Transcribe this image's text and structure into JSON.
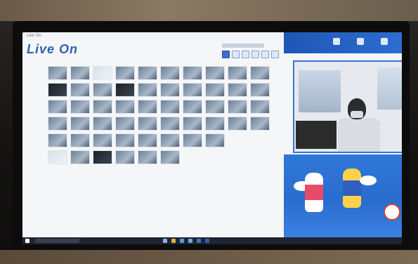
{
  "window": {
    "title": "Live On"
  },
  "app": {
    "brand": "Live On",
    "subtitle": "",
    "status_text": "",
    "page_text": ""
  },
  "video": {
    "label": ""
  },
  "colors": {
    "brand_blue": "#2b5fb8",
    "header_blue": "#1d57b5",
    "mascot_bg": "#2f78d8",
    "taskbar": "#1f2430"
  },
  "taskbar": {
    "search_placeholder": "",
    "clock": ""
  },
  "icons": [
    "windows-icon",
    "search-icon",
    "task-view-icon",
    "chrome-icon",
    "explorer-icon",
    "store-icon",
    "mail-icon",
    "liveon-icon"
  ],
  "thumbnails": {
    "rows": [
      {
        "count": 10,
        "kinds": [
          "n",
          "n",
          "l",
          "n",
          "n",
          "n",
          "n",
          "n",
          "n",
          "n"
        ]
      },
      {
        "count": 10,
        "kinds": [
          "d",
          "n",
          "n",
          "d",
          "n",
          "n",
          "n",
          "n",
          "n",
          "n"
        ]
      },
      {
        "count": 10,
        "kinds": [
          "n",
          "n",
          "n",
          "n",
          "n",
          "n",
          "n",
          "n",
          "n",
          "n"
        ]
      },
      {
        "count": 10,
        "kinds": [
          "n",
          "n",
          "n",
          "n",
          "n",
          "n",
          "n",
          "n",
          "n",
          "n"
        ]
      },
      {
        "count": 8,
        "kinds": [
          "n",
          "n",
          "n",
          "n",
          "n",
          "n",
          "n",
          "n"
        ]
      },
      {
        "count": 6,
        "kinds": [
          "l",
          "n",
          "d",
          "n",
          "n",
          "n"
        ]
      }
    ]
  }
}
